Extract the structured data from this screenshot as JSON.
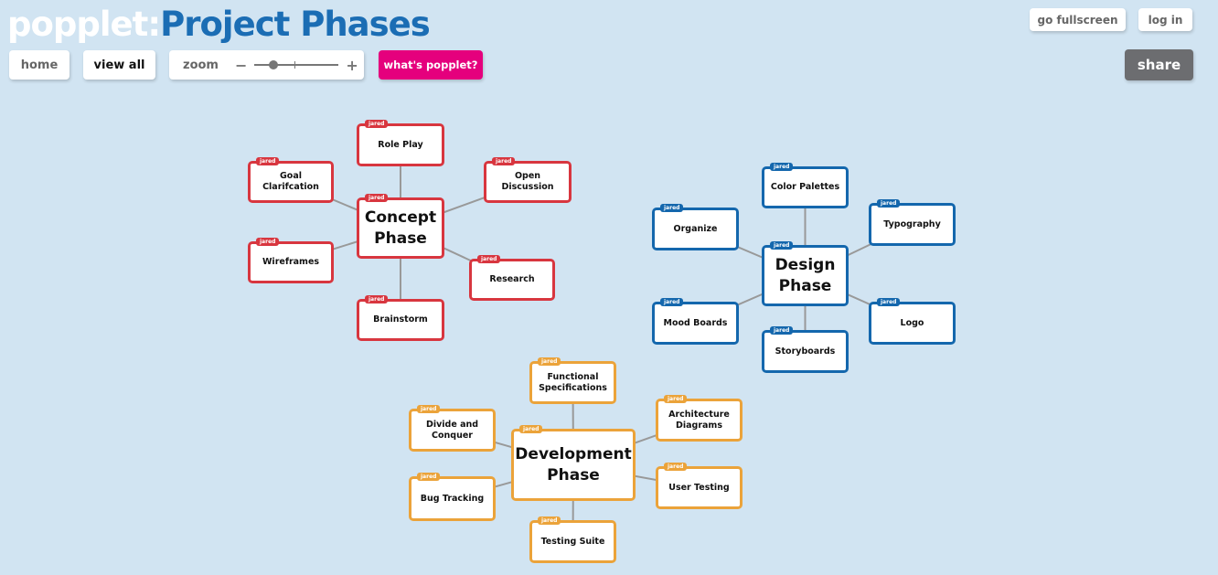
{
  "header": {
    "brand": "popplet:",
    "board_title": "Project Phases"
  },
  "toolbar": {
    "home": "home",
    "view_all": "view all",
    "zoom_label": "zoom",
    "zoom_minus": "−",
    "zoom_plus": "+",
    "zoom_level": 0.2,
    "whats_popplet": "what's popplet?"
  },
  "top_right": {
    "fullscreen": "go fullscreen",
    "login": "log in",
    "share": "share"
  },
  "colors": {
    "concept": "#d8363f",
    "design": "#1467ad",
    "development": "#eba33a"
  },
  "groups": [
    {
      "id": "concept",
      "center": {
        "label": "Concept Phase",
        "author": "jared"
      },
      "children": [
        {
          "label": "Role Play",
          "author": "jared"
        },
        {
          "label": "Goal Clarifcation",
          "author": "jared"
        },
        {
          "label": "Open Discussion",
          "author": "jared"
        },
        {
          "label": "Wireframes",
          "author": "jared"
        },
        {
          "label": "Research",
          "author": "jared"
        },
        {
          "label": "Brainstorm",
          "author": "jared"
        }
      ]
    },
    {
      "id": "design",
      "center": {
        "label": "Design Phase",
        "author": "jared"
      },
      "children": [
        {
          "label": "Color Palettes",
          "author": "jared"
        },
        {
          "label": "Organize",
          "author": "jared"
        },
        {
          "label": "Typography",
          "author": "jared"
        },
        {
          "label": "Mood Boards",
          "author": "jared"
        },
        {
          "label": "Logo",
          "author": "jared"
        },
        {
          "label": "Storyboards",
          "author": "jared"
        }
      ]
    },
    {
      "id": "development",
      "center": {
        "label": "Development Phase",
        "author": "jared"
      },
      "children": [
        {
          "label": "Functional Specifications",
          "author": "jared"
        },
        {
          "label": "Divide and Conquer",
          "author": "jared"
        },
        {
          "label": "Architecture Diagrams",
          "author": "jared"
        },
        {
          "label": "Bug Tracking",
          "author": "jared"
        },
        {
          "label": "User Testing",
          "author": "jared"
        },
        {
          "label": "Testing Suite",
          "author": "jared"
        }
      ]
    }
  ]
}
